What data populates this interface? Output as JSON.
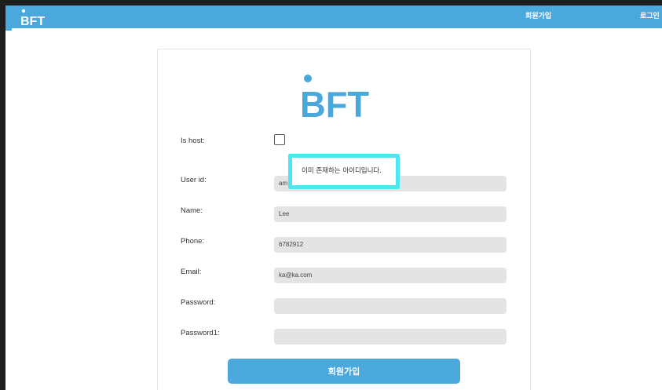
{
  "nav": {
    "logo_text": "BFT",
    "signup_label": "회원가입",
    "login_label": "로그인"
  },
  "form": {
    "logo_text": "BFT",
    "is_host_label": "Is host:",
    "is_host_checked": false,
    "error_tooltip": "이미 존재하는 아이디입니다.",
    "user_id_label": "User id:",
    "user_id_value": "am  23",
    "name_label": "Name:",
    "name_value": "Lee",
    "phone_label": "Phone:",
    "phone_value": "6782912",
    "email_label": "Email:",
    "email_value": "ka@ka.com",
    "password_label": "Password:",
    "password_value": "",
    "password1_label": "Password1:",
    "password1_value": "",
    "submit_label": "회원가입"
  },
  "colors": {
    "brand": "#4aa8dc",
    "tooltip_border": "#4de8ef",
    "field_bg": "#e4e4e4"
  }
}
